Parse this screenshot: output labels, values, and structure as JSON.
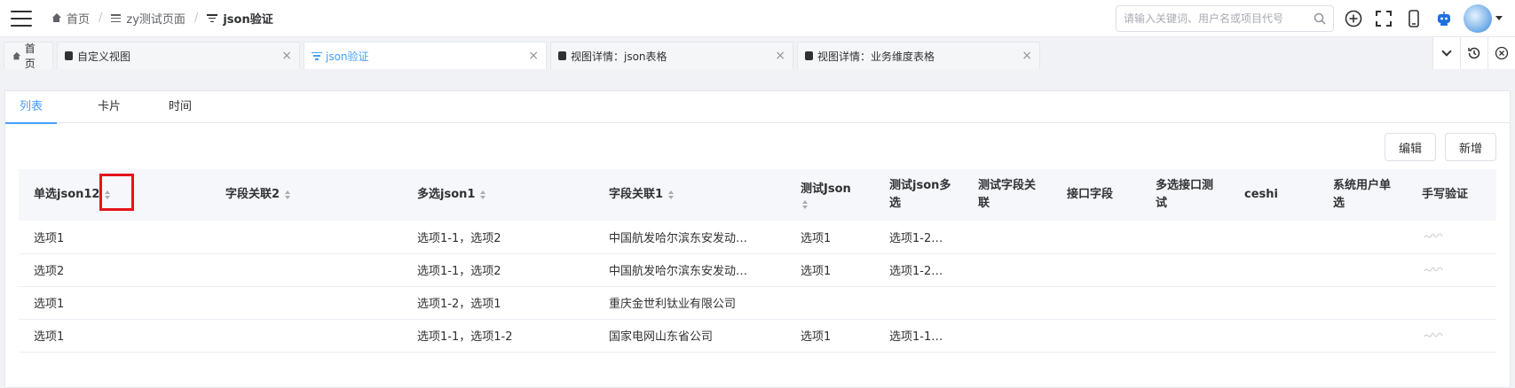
{
  "header": {
    "breadcrumbs": [
      {
        "label": "首页",
        "icon": "home-icon"
      },
      {
        "label": "zy测试页面",
        "icon": "menu-icon"
      },
      {
        "label": "json验证",
        "icon": "filter-icon"
      }
    ],
    "search_placeholder": "请输入关键词、用户名或项目代号",
    "tools": [
      "add-circle-icon",
      "fullscreen-icon",
      "mobile-icon",
      "robot-icon",
      "avatar"
    ]
  },
  "tabs": [
    {
      "label": "首页",
      "icon": "home-icon",
      "closable": false,
      "active": false
    },
    {
      "label": "自定义视图",
      "icon": "doc-icon",
      "closable": true,
      "active": false
    },
    {
      "label": "json验证",
      "icon": "filter-icon",
      "closable": true,
      "active": true
    },
    {
      "label": "视图详情：json表格",
      "icon": "doc-icon",
      "closable": true,
      "active": false
    },
    {
      "label": "视图详情：业务维度表格",
      "icon": "doc-icon",
      "closable": true,
      "active": false
    }
  ],
  "view_tabs": [
    "列表",
    "卡片",
    "时间"
  ],
  "active_view": "列表",
  "buttons": {
    "edit": "编辑",
    "add": "新增"
  },
  "table": {
    "columns": [
      "单选json12",
      "字段关联2",
      "多选json1",
      "字段关联1",
      "测试Json",
      "测试json多选",
      "测试字段关联",
      "接口字段",
      "多选接口测试",
      "ceshi",
      "系统用户单选",
      "手写验证"
    ],
    "rows": [
      [
        "选项1",
        "",
        "选项1-1，选项2",
        "中国航发哈尔滨东安发动…",
        "选项1",
        "选项1-2…",
        "",
        "",
        "",
        "",
        "",
        "signature"
      ],
      [
        "选项2",
        "",
        "选项1-1，选项2",
        "中国航发哈尔滨东安发动…",
        "选项1",
        "选项1-2…",
        "",
        "",
        "",
        "",
        "",
        "signature"
      ],
      [
        "选项1",
        "",
        "选项1-2，选项1",
        "重庆金世利钛业有限公司",
        "",
        "",
        "",
        "",
        "",
        "",
        "",
        ""
      ],
      [
        "选项1",
        "",
        "选项1-1，选项1-2",
        "国家电网山东省公司",
        "选项1",
        "选项1-1…",
        "",
        "",
        "",
        "",
        "",
        "signature"
      ]
    ]
  },
  "colors": {
    "accent": "#409eff",
    "highlight": "#e5141a"
  }
}
